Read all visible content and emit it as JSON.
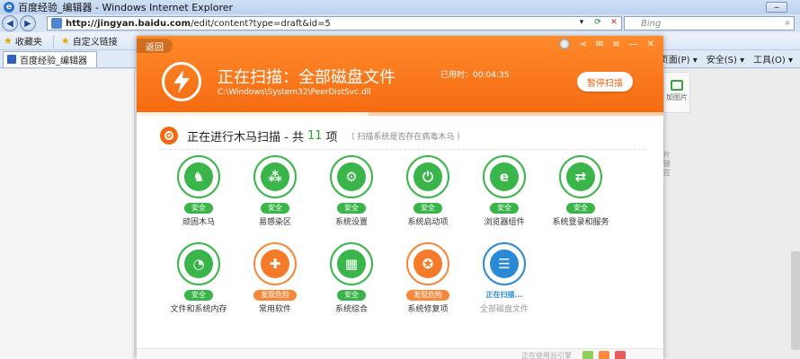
{
  "window": {
    "title": "百度经验_编辑器 - Windows Internet Explorer",
    "min_label": "−"
  },
  "address": {
    "url_host": "http://jingyan.baidu.com",
    "url_path": "/edit/content?type=draft&id=5",
    "search_placeholder": "Bing"
  },
  "favbar": {
    "favorites": "收藏夹",
    "custom_links": "自定义链接"
  },
  "tab": {
    "label": "百度经验_编辑器"
  },
  "cmdbar": {
    "page": "页面(P) ▾",
    "safety": "安全(S) ▾",
    "tools": "工具(O) ▾"
  },
  "right_panel": {
    "add_image": "加图片",
    "side_text": [
      "片",
      "键",
      "在"
    ]
  },
  "popup": {
    "back": "返回",
    "title": "正在扫描：全部磁盘文件",
    "path": "C:\\Windows\\System32\\PeerDistSvc.dll",
    "elapsed": "已用时：00:04:35",
    "pause": "暂停扫描",
    "progress": 0.44,
    "section_title": "正在进行木马扫描 - 共",
    "section_count": "11",
    "section_unit": "项",
    "section_sub": "（ 扫描系统是否存在病毒木马 ）",
    "items": [
      {
        "label": "顽固木马",
        "status": "安全",
        "kind": "g"
      },
      {
        "label": "易感染区",
        "status": "安全",
        "kind": "g"
      },
      {
        "label": "系统设置",
        "status": "安全",
        "kind": "g"
      },
      {
        "label": "系统启动项",
        "status": "安全",
        "kind": "g"
      },
      {
        "label": "浏览器组件",
        "status": "安全",
        "kind": "g"
      },
      {
        "label": "系统登录和服务",
        "status": "安全",
        "kind": "g"
      },
      {
        "label": "文件和系统内存",
        "status": "安全",
        "kind": "g"
      },
      {
        "label": "常用软件",
        "status": "发现危险",
        "kind": "o"
      },
      {
        "label": "系统综合",
        "status": "安全",
        "kind": "g"
      },
      {
        "label": "系统修复项",
        "status": "发现危险",
        "kind": "o"
      },
      {
        "label": "全部磁盘文件",
        "status": "正在扫描...",
        "kind": "b"
      }
    ],
    "footer": "正在使用云引擎"
  },
  "colors": {
    "accent": "#f56a10",
    "safe": "#39b54a",
    "danger": "#f5883a",
    "scanning": "#2b8ad6"
  }
}
